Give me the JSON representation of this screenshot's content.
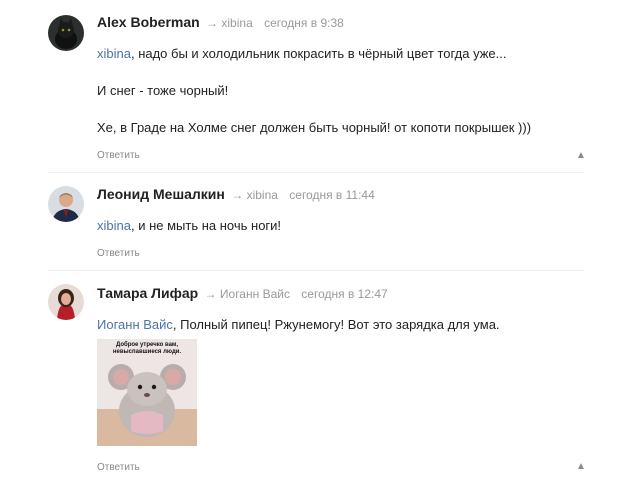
{
  "comments": [
    {
      "author": "Alex Boberman",
      "arrow": "→",
      "to": "xibina",
      "time": "сегодня в 9:38",
      "lines": [
        {
          "mention": "xibina",
          "text": ", надо бы и холодильник покрасить в чёрный цвет тогда уже..."
        },
        {
          "mention": "",
          "text": "И снег - тоже чорный!"
        },
        {
          "mention": "",
          "text": "Хе, в Граде на Холме снег должен быть чорный! от копоти покрышек )))"
        }
      ],
      "reply": "Ответить",
      "up": "▲"
    },
    {
      "author": "Леонид Мешалкин",
      "arrow": "→",
      "to": "xibina",
      "time": "сегодня в 11:44",
      "lines": [
        {
          "mention": "xibina",
          "text": ", и не мыть на ночь ноги!"
        }
      ],
      "reply": "Ответить",
      "up": "▲"
    },
    {
      "author": "Тамара Лифар",
      "arrow": "→",
      "to": "Иоганн Вайс",
      "time": "сегодня в 12:47",
      "lines": [
        {
          "mention": "Иоганн Вайс",
          "text": ", Полный пипец! Ржунемогу! Вот это зарядка для ума."
        }
      ],
      "image_caption": [
        "Доброе утречко вам,",
        "невыспавшиеся люди."
      ],
      "reply": "Ответить",
      "up": "▲"
    }
  ],
  "colors": {
    "link": "#4b74a8",
    "meta": "#999999",
    "text": "#222222"
  }
}
